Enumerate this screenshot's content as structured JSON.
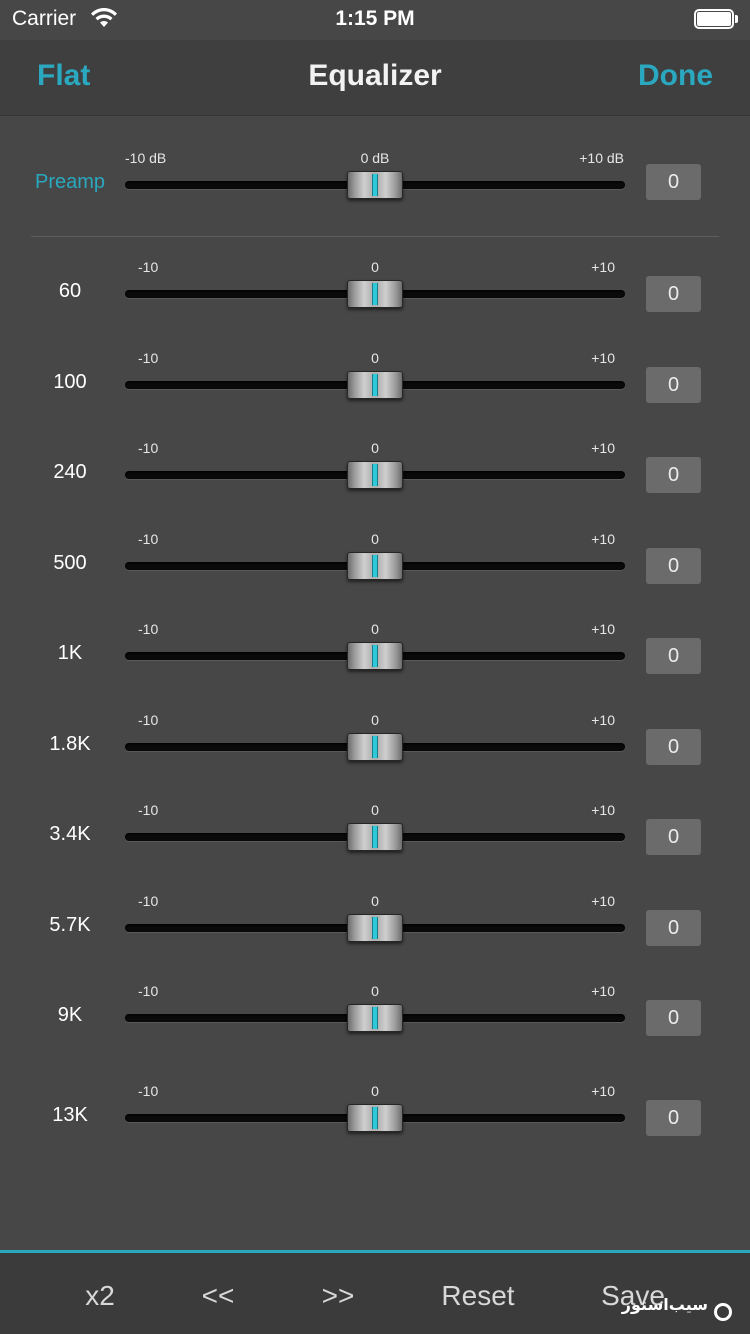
{
  "status_bar": {
    "carrier": "Carrier",
    "time": "1:15 PM"
  },
  "nav": {
    "left_button": "Flat",
    "title": "Equalizer",
    "right_button": "Done"
  },
  "preamp": {
    "label": "Preamp",
    "min_label": "-10 dB",
    "mid_label": "0 dB",
    "max_label": "+10 dB",
    "value": "0",
    "level": 0
  },
  "bands": [
    {
      "label": "60",
      "min_label": "-10",
      "mid_label": "0",
      "max_label": "+10",
      "value": "0",
      "level": 0
    },
    {
      "label": "100",
      "min_label": "-10",
      "mid_label": "0",
      "max_label": "+10",
      "value": "0",
      "level": 0
    },
    {
      "label": "240",
      "min_label": "-10",
      "mid_label": "0",
      "max_label": "+10",
      "value": "0",
      "level": 0
    },
    {
      "label": "500",
      "min_label": "-10",
      "mid_label": "0",
      "max_label": "+10",
      "value": "0",
      "level": 0
    },
    {
      "label": "1K",
      "min_label": "-10",
      "mid_label": "0",
      "max_label": "+10",
      "value": "0",
      "level": 0
    },
    {
      "label": "1.8K",
      "min_label": "-10",
      "mid_label": "0",
      "max_label": "+10",
      "value": "0",
      "level": 0
    },
    {
      "label": "3.4K",
      "min_label": "-10",
      "mid_label": "0",
      "max_label": "+10",
      "value": "0",
      "level": 0
    },
    {
      "label": "5.7K",
      "min_label": "-10",
      "mid_label": "0",
      "max_label": "+10",
      "value": "0",
      "level": 0
    },
    {
      "label": "9K",
      "min_label": "-10",
      "mid_label": "0",
      "max_label": "+10",
      "value": "0",
      "level": 0
    },
    {
      "label": "13K",
      "min_label": "-10",
      "mid_label": "0",
      "max_label": "+10",
      "value": "0",
      "level": 0
    }
  ],
  "toolbar": {
    "x2": "x2",
    "prev": "<<",
    "next": ">>",
    "reset": "Reset",
    "save": "Save"
  },
  "watermark": "سیب‌استور",
  "colors": {
    "accent": "#2aa8bf",
    "background": "#474747",
    "track": "#0a0a0a",
    "value_box": "#6b6b6b"
  },
  "icons": {
    "wifi": "wifi-icon",
    "battery": "battery-icon"
  }
}
